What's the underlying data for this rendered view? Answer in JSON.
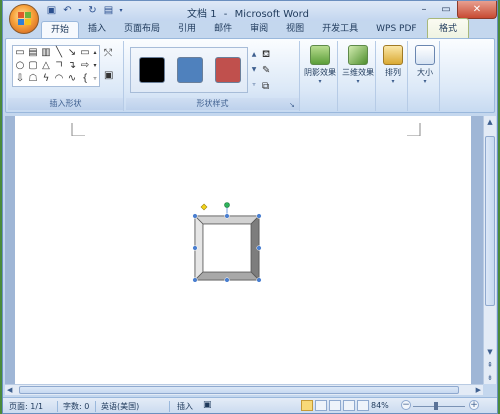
{
  "window": {
    "title": "文档 1",
    "app_name": "Microsoft Word",
    "title_separator": "-"
  },
  "quick_access": {
    "save_icon": "save-icon",
    "undo_icon": "undo-icon",
    "redo_icon": "redo-icon",
    "print_icon": "print-preview-icon"
  },
  "tabs": [
    {
      "label": "开始"
    },
    {
      "label": "插入"
    },
    {
      "label": "页面布局"
    },
    {
      "label": "引用"
    },
    {
      "label": "邮件"
    },
    {
      "label": "审阅"
    },
    {
      "label": "视图"
    },
    {
      "label": "开发工具"
    },
    {
      "label": "WPS PDF"
    }
  ],
  "context_tab": {
    "label": "格式"
  },
  "ribbon": {
    "insert_shapes_label": "插入形状",
    "shape_styles_label": "形状样式",
    "shadow_effects_label": "阴影效果",
    "three_d_effects_label": "三维效果",
    "arrange_label": "排列",
    "size_label": "大小",
    "swatch_colors": [
      "#000000",
      "#4f81bd",
      "#c0504d"
    ]
  },
  "statusbar": {
    "page": "页面: 1/1",
    "words": "字数: 0",
    "language": "英语(美国)",
    "mode": "插入",
    "zoom": "84%"
  },
  "colors": {
    "shape_handle": "#4a7fd0",
    "rotate_handle": "#2db35b",
    "adjust_handle": "#f2d21a",
    "bevel_dark": "#7d7d7d",
    "bevel_light": "#d2d2d2"
  }
}
